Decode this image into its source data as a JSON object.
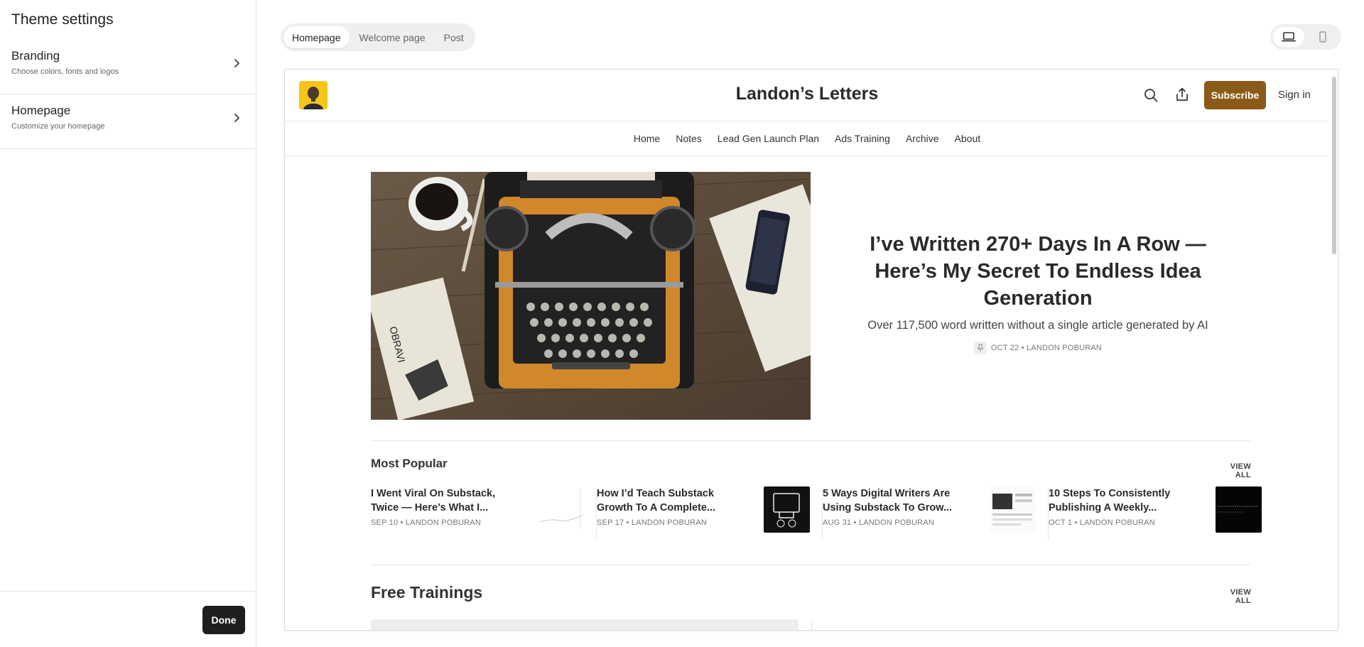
{
  "sidebar": {
    "title": "Theme settings",
    "items": [
      {
        "label": "Branding",
        "description": "Choose colors, fonts and logos"
      },
      {
        "label": "Homepage",
        "description": "Customize your homepage"
      }
    ],
    "done_label": "Done"
  },
  "preview": {
    "tabs": [
      {
        "label": "Homepage",
        "active": true
      },
      {
        "label": "Welcome page",
        "active": false
      },
      {
        "label": "Post",
        "active": false
      }
    ],
    "device_modes": [
      {
        "icon": "laptop-icon",
        "active": true
      },
      {
        "icon": "mobile-icon",
        "active": false
      }
    ]
  },
  "site": {
    "title": "Landon’s Letters",
    "subscribe_label": "Subscribe",
    "signin_label": "Sign in",
    "accent_color": "#8b5a18",
    "logo_bg": "#f5c518",
    "nav": [
      "Home",
      "Notes",
      "Lead Gen Launch Plan",
      "Ads Training",
      "Archive",
      "About"
    ],
    "hero": {
      "title": "I’ve Written 270+ Days In A Row — Here’s My Secret To Endless Idea Generation",
      "subtitle": "Over 117,500 word written without a single article generated by AI",
      "meta": "OCT 22 • LANDON POBURAN"
    },
    "most_popular": {
      "title": "Most Popular",
      "view_all": "VIEW ALL",
      "items": [
        {
          "title": "I Went Viral On Substack, Twice — Here’s What I...",
          "meta": "SEP 10 • LANDON POBURAN"
        },
        {
          "title": "How I’d Teach Substack Growth To A Complete...",
          "meta": "SEP 17 • LANDON POBURAN"
        },
        {
          "title": "5 Ways Digital Writers Are Using Substack To Grow...",
          "meta": "AUG 31 • LANDON POBURAN"
        },
        {
          "title": "10 Steps To Consistently Publishing A Weekly...",
          "meta": "OCT 1 • LANDON POBURAN"
        }
      ]
    },
    "free_trainings": {
      "title": "Free Trainings",
      "view_all": "VIEW ALL"
    }
  }
}
